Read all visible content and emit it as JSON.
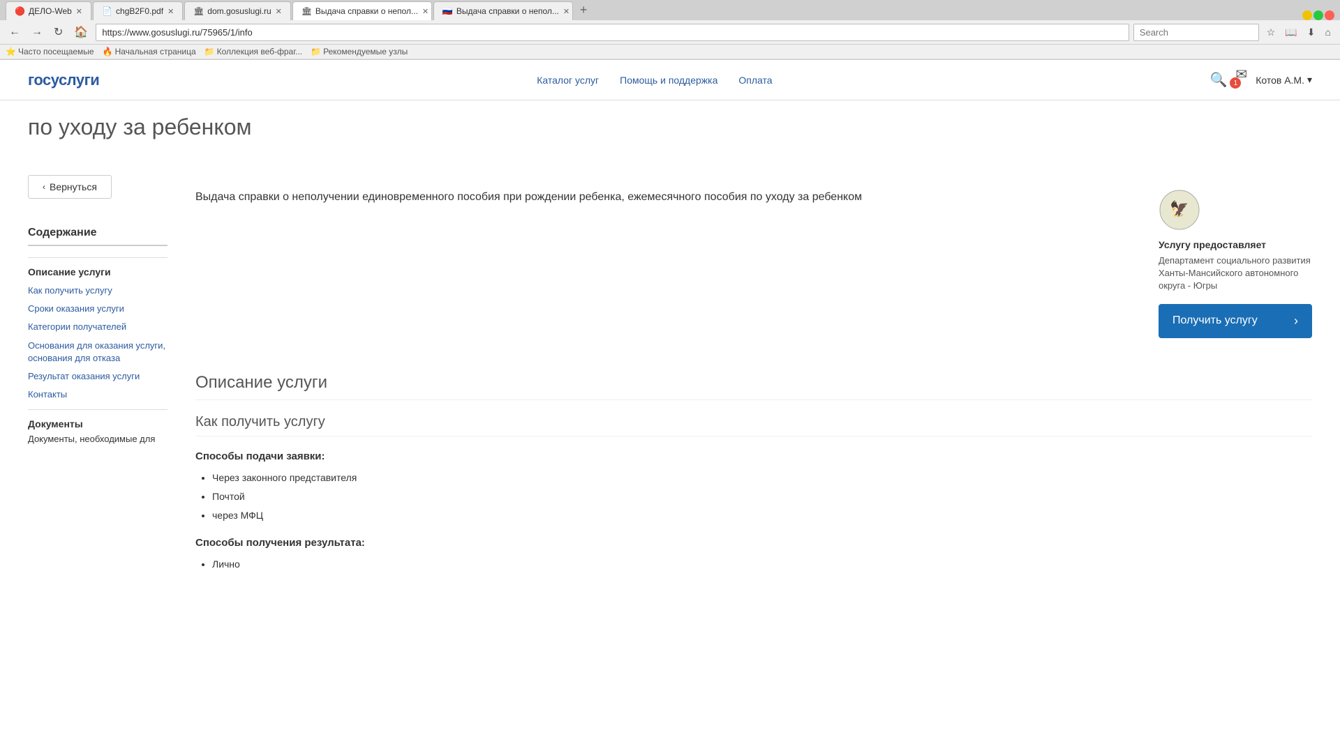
{
  "browser": {
    "tabs": [
      {
        "id": "tab1",
        "title": "ДЕЛО-Web",
        "favicon": "🔴",
        "active": false
      },
      {
        "id": "tab2",
        "title": "chgB2F0.pdf",
        "favicon": "📄",
        "active": false
      },
      {
        "id": "tab3",
        "title": "dom.gosuslugi.ru",
        "favicon": "🏛",
        "active": false
      },
      {
        "id": "tab4",
        "title": "Выдача справки о непол...",
        "favicon": "🏛",
        "active": true
      },
      {
        "id": "tab5",
        "title": "Выдача справки о непол...",
        "favicon": "🇷🇺",
        "active": false
      }
    ],
    "url": "https://www.gosuslugi.ru/75965/1/info",
    "search_placeholder": "Search"
  },
  "bookmarks": [
    {
      "label": "Часто посещаемые",
      "icon": "⭐"
    },
    {
      "label": "Начальная страница",
      "icon": "🔥"
    },
    {
      "label": "Коллекция веб-фраг...",
      "icon": "📁"
    },
    {
      "label": "Рекомендуемые узлы",
      "icon": "📁"
    }
  ],
  "header": {
    "logo": "госуслуги",
    "nav": [
      {
        "label": "Каталог услуг"
      },
      {
        "label": "Помощь и поддержка"
      },
      {
        "label": "Оплата"
      }
    ],
    "notification_count": "1",
    "user": "Котов А.М."
  },
  "hero": {
    "title": "по уходу за ребенком"
  },
  "back_button": "Вернуться",
  "service": {
    "full_title": "Выдача справки о неполучении единовременного пособия при рождении ребенка, ежемесячного пособия по уходу за ребенком",
    "provider_label": "Услугу предоставляет",
    "provider_name": "Департамент социального развития Ханты-Мансийского автономного округа - Югры",
    "get_service_btn": "Получить услугу"
  },
  "content_nav": {
    "title": "Содержание",
    "section": "Описание услуги",
    "links": [
      "Как получить услугу",
      "Сроки оказания услуги",
      "Категории получателей",
      "Основания для оказания услуги, основания для отказа",
      "Результат оказания услуги",
      "Контакты"
    ],
    "docs_title": "Документы",
    "docs_sub": "Документы, необходимые для"
  },
  "main_content": {
    "section_title": "Описание услуги",
    "how_to_title": "Как получить услугу",
    "submission_methods_label": "Способы подачи заявки:",
    "submission_methods": [
      "Через законного представителя",
      "Почтой",
      "через МФЦ"
    ],
    "result_methods_label": "Способы получения результата:",
    "result_methods": [
      "Лично"
    ]
  }
}
